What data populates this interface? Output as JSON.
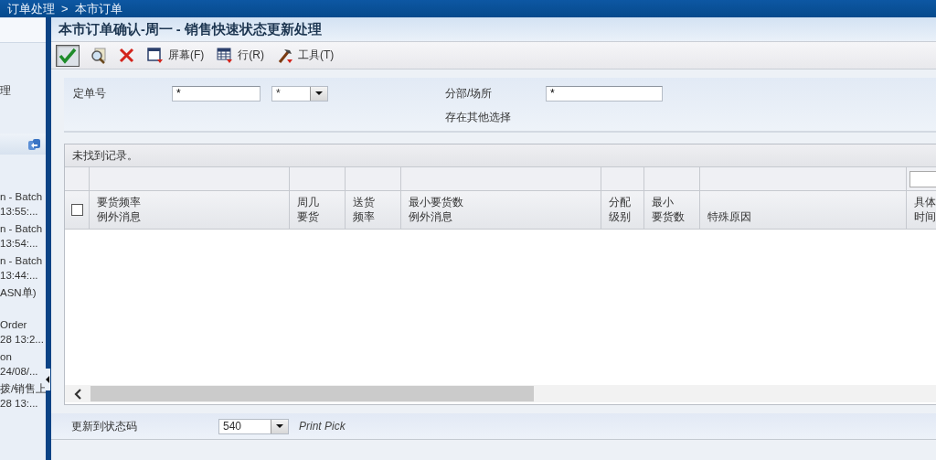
{
  "breadcrumb": {
    "separator": ">",
    "items": [
      {
        "label": "订单处理"
      },
      {
        "label": "本市订单"
      }
    ]
  },
  "sidebar": {
    "fragment": "理",
    "items": [
      {
        "lines": [
          "n - Batch",
          "13:55:..."
        ]
      },
      {
        "lines": [
          "n - Batch",
          "13:54:..."
        ]
      },
      {
        "lines": [
          "n - Batch",
          "13:44:..."
        ]
      },
      {
        "lines": [
          "ASN单)"
        ]
      },
      {
        "lines": [
          "Order",
          "28 13:2..."
        ]
      },
      {
        "lines": [
          "on",
          "24/08/..."
        ]
      },
      {
        "lines": [
          "拨/销售上",
          "28 13:..."
        ]
      }
    ]
  },
  "window": {
    "title": "本市订单确认-周一 - 销售快速状态更新处理"
  },
  "toolbar": [
    {
      "kind": "ok",
      "selected": true
    },
    {
      "kind": "find",
      "selected": false
    },
    {
      "kind": "cancel",
      "selected": false
    },
    {
      "kind": "screen",
      "label": "屏幕(F)",
      "selected": false
    },
    {
      "kind": "row",
      "label": "行(R)",
      "selected": false
    },
    {
      "kind": "tools",
      "label": "工具(T)",
      "selected": false
    }
  ],
  "form": {
    "order_label": "定单号",
    "order_value": "*",
    "order_type_value": "*",
    "branch_label": "分部/场所",
    "branch_value": "*",
    "more_options": "存在其他选择"
  },
  "table": {
    "status": "未找到记录。",
    "select_all": {
      "checked": false
    },
    "columns": [
      {
        "lines": [
          "要货频率",
          "例外消息"
        ],
        "filter_field": false
      },
      {
        "lines": [
          "周几",
          "要货"
        ],
        "filter_field": false
      },
      {
        "lines": [
          "送货",
          "频率"
        ],
        "filter_field": false
      },
      {
        "lines": [
          "最小要货数",
          "例外消息"
        ],
        "filter_field": false
      },
      {
        "lines": [
          "分配",
          "级别"
        ],
        "filter_field": false
      },
      {
        "lines": [
          "最小",
          "要货数"
        ],
        "filter_field": false
      },
      {
        "lines": [
          "特殊原因"
        ],
        "filter_field": false
      },
      {
        "lines": [
          "具体",
          "时间"
        ],
        "filter_field": true
      }
    ]
  },
  "footer": {
    "label": "更新到状态码",
    "value": "540",
    "description": "Print Pick"
  }
}
